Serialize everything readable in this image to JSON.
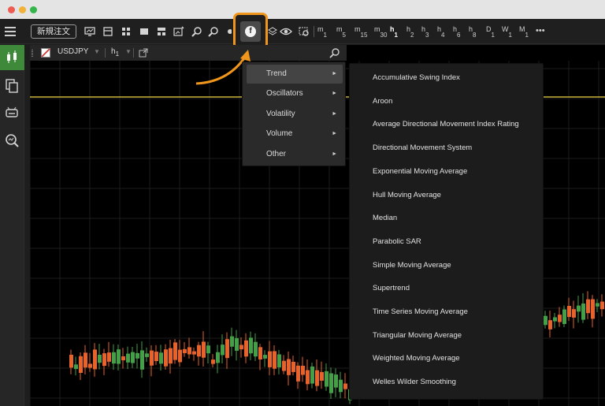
{
  "window": {
    "controls": [
      "close",
      "minimize",
      "maximize"
    ]
  },
  "toolbar": {
    "order_label": "新規注文",
    "timeframes": [
      {
        "base": "m",
        "sub": "1",
        "active": false
      },
      {
        "base": "m",
        "sub": "5",
        "active": false
      },
      {
        "base": "m",
        "sub": "15",
        "active": false
      },
      {
        "base": "m",
        "sub": "30",
        "active": false
      },
      {
        "base": "h",
        "sub": "1",
        "active": true
      },
      {
        "base": "h",
        "sub": "2",
        "active": false
      },
      {
        "base": "h",
        "sub": "3",
        "active": false
      },
      {
        "base": "h",
        "sub": "4",
        "active": false
      },
      {
        "base": "h",
        "sub": "6",
        "active": false
      },
      {
        "base": "h",
        "sub": "8",
        "active": false
      },
      {
        "base": "D",
        "sub": "1",
        "active": false
      },
      {
        "base": "W",
        "sub": "1",
        "active": false
      },
      {
        "base": "M",
        "sub": "1",
        "active": false
      }
    ],
    "more_label": "•••",
    "indicator_glyph": "f"
  },
  "chart": {
    "symbol": "USDJPY",
    "timeframe_base": "h",
    "timeframe_sub": "1",
    "arrow": "▼"
  },
  "indicator_menu": {
    "items": [
      {
        "label": "Trend",
        "active": true
      },
      {
        "label": "Oscillators",
        "active": false
      },
      {
        "label": "Volatility",
        "active": false
      },
      {
        "label": "Volume",
        "active": false
      },
      {
        "label": "Other",
        "active": false
      }
    ],
    "arrow": "►"
  },
  "trend_submenu": {
    "items": [
      "Accumulative Swing Index",
      "Aroon",
      "Average Directional Movement Index Rating",
      "Directional Movement System",
      "Exponential Moving Average",
      "Hull Moving Average",
      "Median",
      "Parabolic SAR",
      "Simple Moving Average",
      "Supertrend",
      "Time Series Moving Average",
      "Triangular Moving Average",
      "Weighted Moving Average",
      "Welles Wilder Smoothing"
    ]
  },
  "colors": {
    "accent_highlight": "#f0961c",
    "sidebar_active": "#3f8a3a",
    "bull_candle": "#43a047",
    "bear_candle": "#e8622a",
    "level_line": "#c8b33a"
  }
}
